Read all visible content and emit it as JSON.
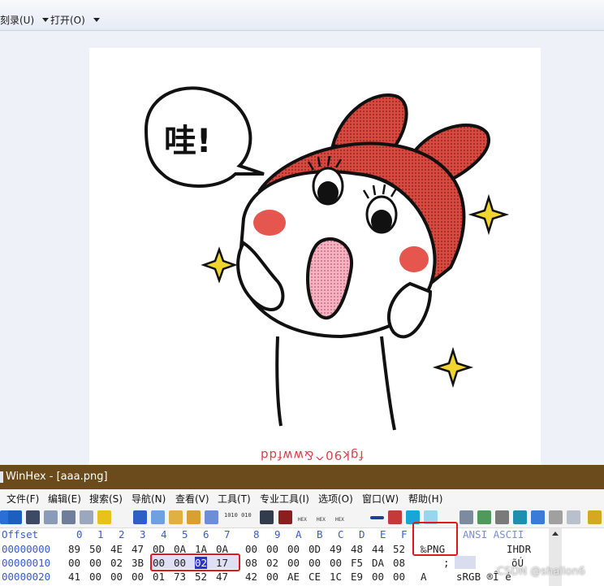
{
  "viewer": {
    "toolbar": {
      "catalog_label": "刻录(U)",
      "open_label": "打开(O)"
    },
    "image": {
      "speech_text": "哇!",
      "mirrored_caption": "fgk90^&wwfdd"
    }
  },
  "winhex": {
    "title": "WinHex - [aaa.png]",
    "menu": [
      "文件(F)",
      "编辑(E)",
      "搜索(S)",
      "导航(N)",
      "查看(V)",
      "工具(T)",
      "专业工具(I)",
      "选项(O)",
      "窗口(W)",
      "帮助(H)"
    ],
    "toolbar_texts": [
      "HEX",
      "HEX",
      "HEX",
      "1010 010"
    ],
    "columns_header": {
      "offset": "Offset",
      "cols": [
        "0",
        "1",
        "2",
        "3",
        "4",
        "5",
        "6",
        "7",
        "8",
        "9",
        "A",
        "B",
        "C",
        "D",
        "E",
        "F"
      ],
      "ascii": "ANSI ASCII"
    },
    "rows": [
      {
        "offset": "00000000",
        "bytes": [
          "89",
          "50",
          "4E",
          "47",
          "0D",
          "0A",
          "1A",
          "0A",
          "00",
          "00",
          "00",
          "0D",
          "49",
          "48",
          "44",
          "52"
        ],
        "ascii": "‰PNG",
        "ascii2": "IHDR"
      },
      {
        "offset": "00000010",
        "bytes": [
          "00",
          "00",
          "02",
          "3B",
          "00",
          "00",
          "02",
          "17",
          "08",
          "02",
          "00",
          "00",
          "00",
          "F5",
          "DA",
          "08"
        ],
        "ascii": ";",
        "ascii2": "õÚ"
      },
      {
        "offset": "00000020",
        "bytes": [
          "41",
          "00",
          "00",
          "00",
          "01",
          "73",
          "52",
          "47",
          "42",
          "00",
          "AE",
          "CE",
          "1C",
          "E9",
          "00",
          "00"
        ],
        "ascii": "A",
        "ascii2": "sRGB ®Î é"
      }
    ],
    "selected_byte": "02"
  },
  "watermark": "CSDN @shallon6",
  "colors": {
    "title_bar": "#6b4a1c",
    "offset_blue": "#3a5ad0",
    "highlight_red": "#e0191b",
    "selection": "#2a34c8",
    "headband_red": "#d9493f",
    "blush": "#e5564e"
  }
}
